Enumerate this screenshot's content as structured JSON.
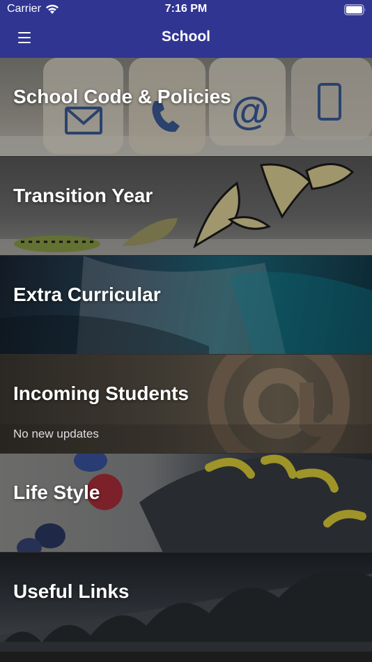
{
  "status_bar": {
    "carrier": "Carrier",
    "time": "7:16 PM"
  },
  "nav": {
    "title": "School"
  },
  "tiles": [
    {
      "title": "School Code & Policies",
      "subtitle": ""
    },
    {
      "title": "Transition Year",
      "subtitle": ""
    },
    {
      "title": "Extra Curricular",
      "subtitle": ""
    },
    {
      "title": "Incoming Students",
      "subtitle": "No new updates"
    },
    {
      "title": "Life Style",
      "subtitle": ""
    },
    {
      "title": "Useful Links",
      "subtitle": ""
    }
  ],
  "colors": {
    "nav_bar": "#303592",
    "text": "#ffffff"
  },
  "icons": [
    "menu-icon",
    "wifi-icon",
    "battery-icon"
  ]
}
